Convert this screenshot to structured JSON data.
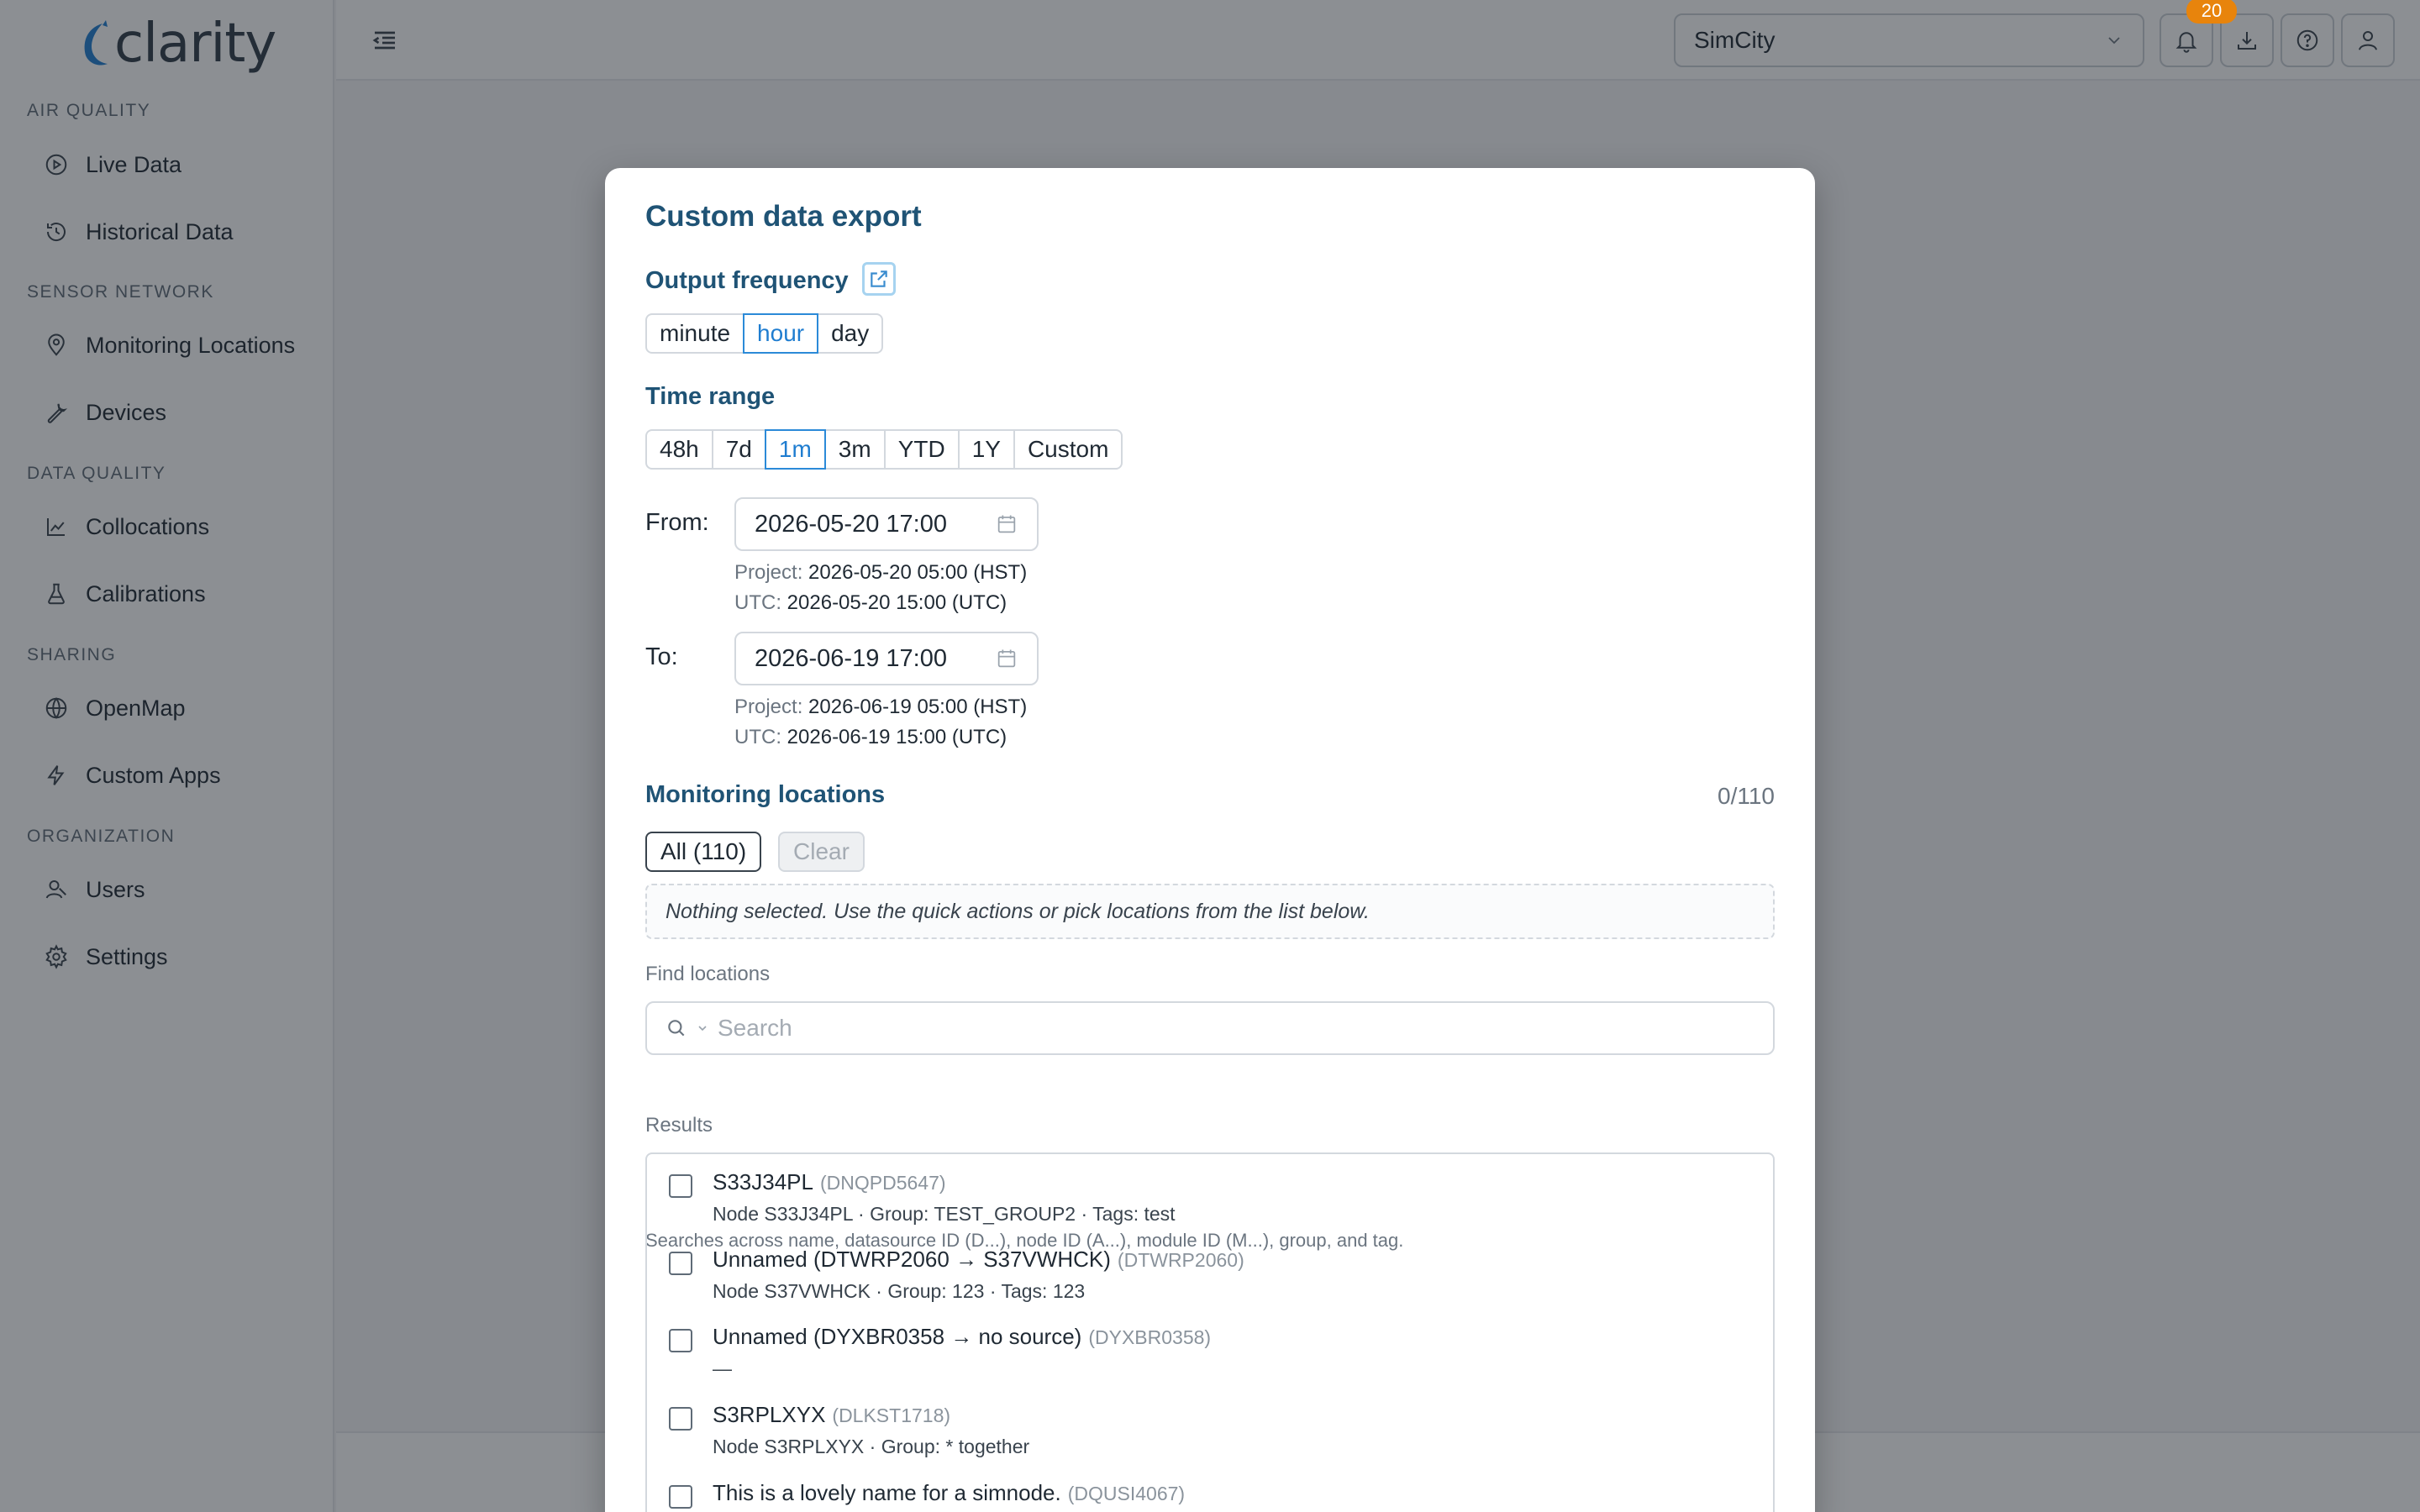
{
  "app": {
    "logo_text": "clarity"
  },
  "sidebar": {
    "sections": [
      {
        "title": "AIR QUALITY",
        "items": [
          {
            "label": "Live Data",
            "icon": "play-circle-icon"
          },
          {
            "label": "Historical Data",
            "icon": "history-icon"
          }
        ]
      },
      {
        "title": "SENSOR NETWORK",
        "items": [
          {
            "label": "Monitoring Locations",
            "icon": "map-pin-icon"
          },
          {
            "label": "Devices",
            "icon": "wrench-icon"
          }
        ]
      },
      {
        "title": "DATA QUALITY",
        "items": [
          {
            "label": "Collocations",
            "icon": "line-chart-icon"
          },
          {
            "label": "Calibrations",
            "icon": "flask-icon"
          }
        ]
      },
      {
        "title": "SHARING",
        "items": [
          {
            "label": "OpenMap",
            "icon": "globe-icon"
          },
          {
            "label": "Custom Apps",
            "icon": "bolt-icon"
          }
        ]
      },
      {
        "title": "ORGANIZATION",
        "items": [
          {
            "label": "Users",
            "icon": "users-icon"
          },
          {
            "label": "Settings",
            "icon": "gear-icon"
          }
        ]
      }
    ]
  },
  "topbar": {
    "project": "SimCity",
    "notification_count": "20"
  },
  "modal": {
    "title": "Custom data export",
    "output_frequency": {
      "heading": "Output frequency",
      "options": [
        "minute",
        "hour",
        "day"
      ],
      "selected": "hour"
    },
    "time_range": {
      "heading": "Time range",
      "options": [
        "48h",
        "7d",
        "1m",
        "3m",
        "YTD",
        "1Y",
        "Custom"
      ],
      "selected": "1m"
    },
    "from": {
      "label": "From:",
      "value": "2026-05-20 17:00",
      "project_key": "Project:",
      "project_value": "2026-05-20 05:00 (HST)",
      "utc_key": "UTC:",
      "utc_value": "2026-05-20 15:00 (UTC)"
    },
    "to": {
      "label": "To:",
      "value": "2026-06-19 17:00",
      "project_key": "Project:",
      "project_value": "2026-06-19 05:00 (HST)",
      "utc_key": "UTC:",
      "utc_value": "2026-06-19 15:00 (UTC)"
    },
    "locations": {
      "heading": "Monitoring locations",
      "counter": "0/110",
      "all_label": "All (110)",
      "clear_label": "Clear",
      "empty_note": "Nothing selected. Use the quick actions or pick locations from the list below.",
      "find_label": "Find locations",
      "search_placeholder": "Search",
      "search_help": "Searches across name, datasource ID (D...), node ID (A...), module ID (M...), group, and tag.",
      "results_label": "Results",
      "results": [
        {
          "name": "S33J34PL",
          "ds": "(DNQPD5647)",
          "detail": "Node S33J34PL · Group: TEST_GROUP2 · Tags: test"
        },
        {
          "name": "Unnamed (DTWRP2060 → S37VWHCK)",
          "ds": "(DTWRP2060)",
          "detail": "Node S37VWHCK · Group: 123 · Tags: 123"
        },
        {
          "name": "Unnamed (DYXBR0358 → no source)",
          "ds": "(DYXBR0358)",
          "detail": "—"
        },
        {
          "name": "S3RPLXYX",
          "ds": "(DLKST1718)",
          "detail": "Node S3RPLXYX · Group: * together"
        },
        {
          "name": "This is a lovely name for a simnode.",
          "ds": "(DQUSI4067)",
          "detail": ""
        }
      ]
    }
  },
  "colors": {
    "heading": "#1f5375",
    "accent": "#2b8ad8",
    "badge": "#e8840c"
  }
}
